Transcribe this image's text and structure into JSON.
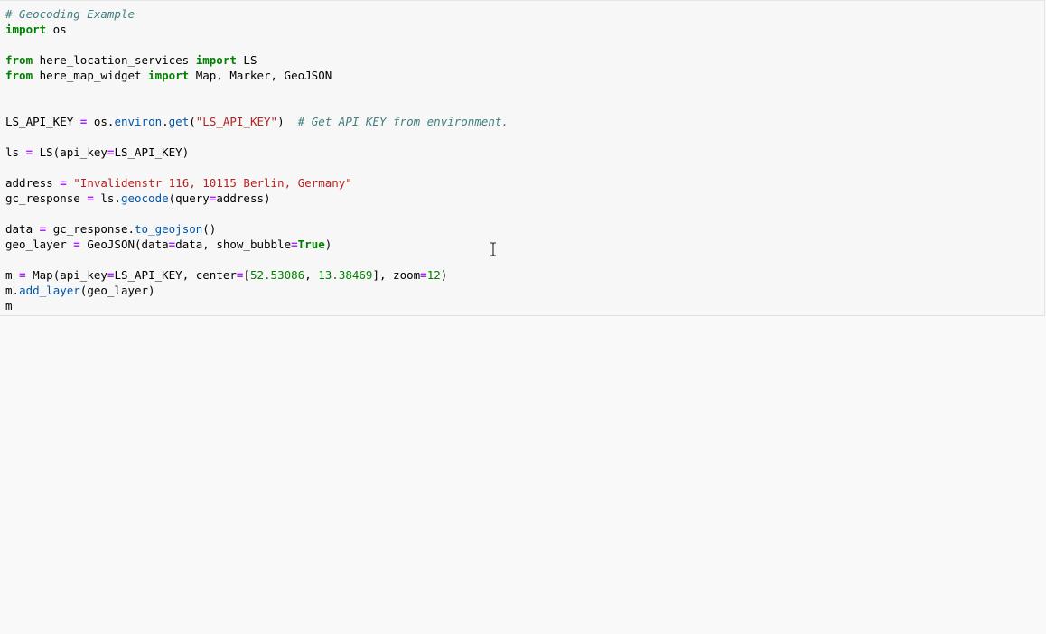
{
  "cell": {
    "lines": [
      [
        {
          "t": "# Geocoding Example",
          "c": "cm"
        }
      ],
      [
        {
          "t": "import",
          "c": "kw"
        },
        {
          "t": " os",
          "c": "plain"
        }
      ],
      [],
      [
        {
          "t": "from",
          "c": "kw"
        },
        {
          "t": " here_location_services ",
          "c": "plain"
        },
        {
          "t": "import",
          "c": "kw"
        },
        {
          "t": " LS",
          "c": "plain"
        }
      ],
      [
        {
          "t": "from",
          "c": "kw"
        },
        {
          "t": " here_map_widget ",
          "c": "plain"
        },
        {
          "t": "import",
          "c": "kw"
        },
        {
          "t": " Map, Marker, GeoJSON",
          "c": "plain"
        }
      ],
      [],
      [],
      [
        {
          "t": "LS_API_KEY ",
          "c": "plain"
        },
        {
          "t": "=",
          "c": "op"
        },
        {
          "t": " os",
          "c": "plain"
        },
        {
          "t": ".",
          "c": "plain"
        },
        {
          "t": "environ",
          "c": "fn"
        },
        {
          "t": ".",
          "c": "plain"
        },
        {
          "t": "get",
          "c": "fn"
        },
        {
          "t": "(",
          "c": "plain"
        },
        {
          "t": "\"LS_API_KEY\"",
          "c": "str"
        },
        {
          "t": ")  ",
          "c": "plain"
        },
        {
          "t": "# Get API KEY from environment.",
          "c": "cm"
        }
      ],
      [],
      [
        {
          "t": "ls ",
          "c": "plain"
        },
        {
          "t": "=",
          "c": "op"
        },
        {
          "t": " LS(api_key",
          "c": "plain"
        },
        {
          "t": "=",
          "c": "op"
        },
        {
          "t": "LS_API_KEY)",
          "c": "plain"
        }
      ],
      [],
      [
        {
          "t": "address ",
          "c": "plain"
        },
        {
          "t": "=",
          "c": "op"
        },
        {
          "t": " ",
          "c": "plain"
        },
        {
          "t": "\"Invalidenstr 116, 10115 Berlin, Germany\"",
          "c": "str"
        }
      ],
      [
        {
          "t": "gc_response ",
          "c": "plain"
        },
        {
          "t": "=",
          "c": "op"
        },
        {
          "t": " ls",
          "c": "plain"
        },
        {
          "t": ".",
          "c": "plain"
        },
        {
          "t": "geocode",
          "c": "fn"
        },
        {
          "t": "(query",
          "c": "plain"
        },
        {
          "t": "=",
          "c": "op"
        },
        {
          "t": "address)",
          "c": "plain"
        }
      ],
      [],
      [
        {
          "t": "data ",
          "c": "plain"
        },
        {
          "t": "=",
          "c": "op"
        },
        {
          "t": " gc_response",
          "c": "plain"
        },
        {
          "t": ".",
          "c": "plain"
        },
        {
          "t": "to_geojson",
          "c": "fn"
        },
        {
          "t": "()",
          "c": "plain"
        }
      ],
      [
        {
          "t": "geo_layer ",
          "c": "plain"
        },
        {
          "t": "=",
          "c": "op"
        },
        {
          "t": " GeoJSON(data",
          "c": "plain"
        },
        {
          "t": "=",
          "c": "op"
        },
        {
          "t": "data, show_bubble",
          "c": "plain"
        },
        {
          "t": "=",
          "c": "op"
        },
        {
          "t": "True",
          "c": "kw"
        },
        {
          "t": ")",
          "c": "plain"
        }
      ],
      [],
      [
        {
          "t": "m ",
          "c": "plain"
        },
        {
          "t": "=",
          "c": "op"
        },
        {
          "t": " Map(api_key",
          "c": "plain"
        },
        {
          "t": "=",
          "c": "op"
        },
        {
          "t": "LS_API_KEY, center",
          "c": "plain"
        },
        {
          "t": "=",
          "c": "op"
        },
        {
          "t": "[",
          "c": "plain"
        },
        {
          "t": "52.53086",
          "c": "num"
        },
        {
          "t": ", ",
          "c": "plain"
        },
        {
          "t": "13.38469",
          "c": "num"
        },
        {
          "t": "], zoom",
          "c": "plain"
        },
        {
          "t": "=",
          "c": "op"
        },
        {
          "t": "12",
          "c": "num"
        },
        {
          "t": ")",
          "c": "plain"
        }
      ],
      [
        {
          "t": "m",
          "c": "plain"
        },
        {
          "t": ".",
          "c": "plain"
        },
        {
          "t": "add_layer",
          "c": "fn"
        },
        {
          "t": "(geo_layer)",
          "c": "plain"
        }
      ],
      [
        {
          "t": "m",
          "c": "plain"
        }
      ]
    ]
  },
  "cursor": {
    "icon": "text-cursor-icon"
  },
  "colors": {
    "keyword": "#008000",
    "comment": "#408080",
    "string": "#ba2121",
    "operator": "#aa22ff",
    "number": "#008000",
    "function": "#0055aa",
    "cell_background": "#f7f7f7",
    "page_background": "#f9f9f9"
  }
}
